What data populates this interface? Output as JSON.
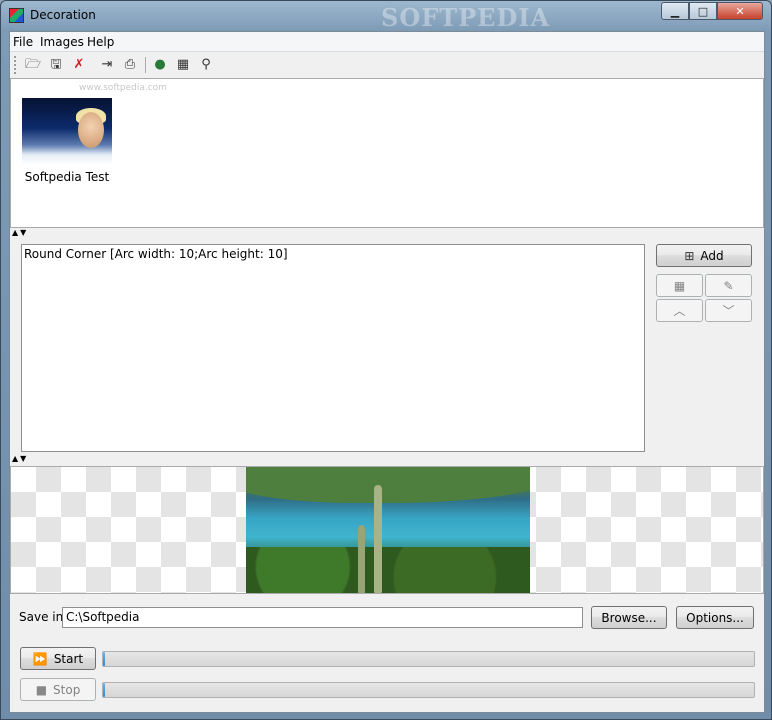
{
  "window": {
    "title": "Decoration",
    "watermark": "SOFTPEDIA",
    "minimize": "▁",
    "maximize": "□",
    "close": "✕"
  },
  "menu": {
    "items": [
      "File",
      "Images",
      "Help"
    ]
  },
  "toolbar": {
    "icons": [
      "open-folder-icon",
      "save-icon",
      "remove-icon",
      "export-icon",
      "print-icon",
      "info-icon",
      "grid-icon",
      "zoom-icon"
    ],
    "watermark": "www.softpedia.com"
  },
  "thumbnails": [
    {
      "label": "Softpedia Test"
    }
  ],
  "decorations": {
    "items": [
      "Round Corner [Arc width: 10;Arc height: 10]"
    ]
  },
  "side_buttons": {
    "add": "Add"
  },
  "save": {
    "label": "Save in:",
    "path": "C:\\Softpedia",
    "browse": "Browse...",
    "options": "Options..."
  },
  "actions": {
    "start": "Start",
    "stop": "Stop",
    "start_progress": 0.0,
    "stop_progress": 0.0
  },
  "colors": {
    "accent": "#2e86d3",
    "titlebar": "#9db8cf"
  }
}
